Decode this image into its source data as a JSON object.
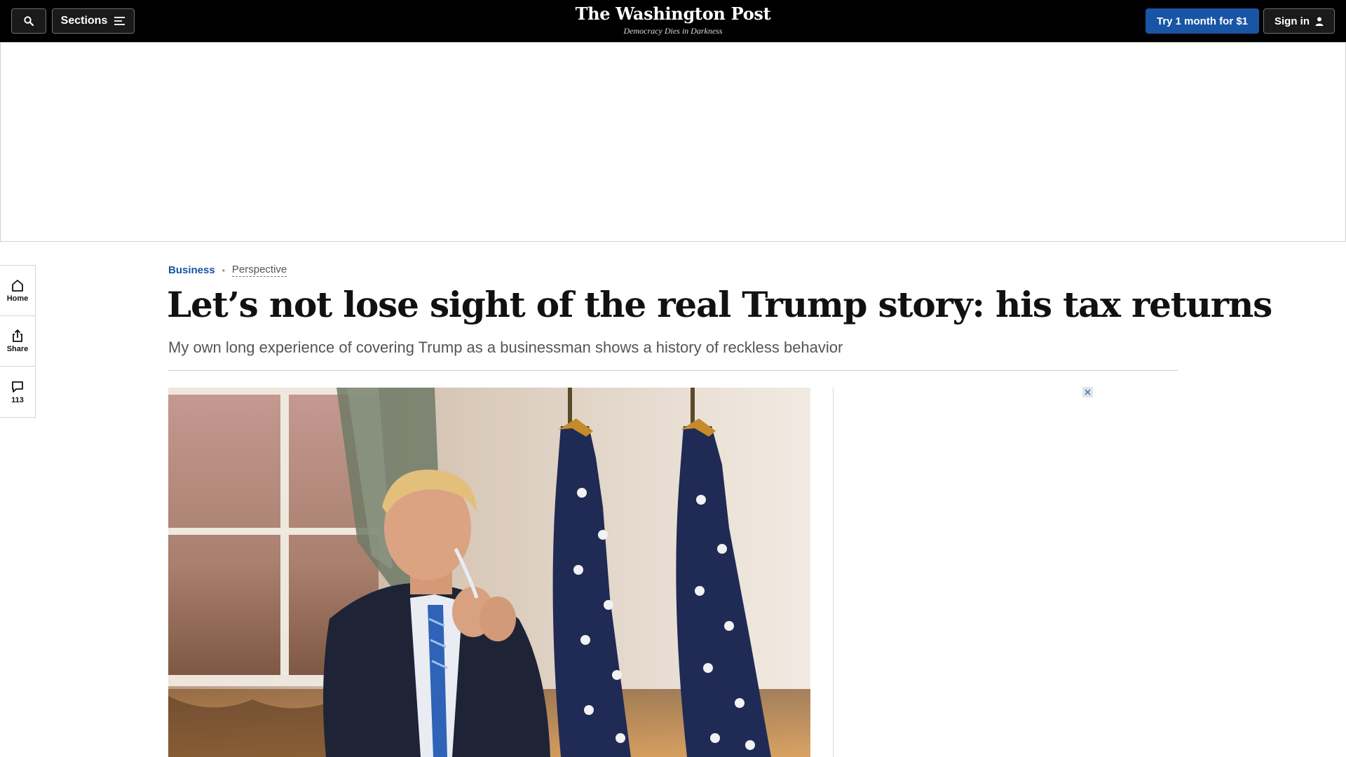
{
  "topbar": {
    "search_icon": "search-icon",
    "sections_label": "Sections",
    "sections_icon": "hamburger-menu-icon",
    "logo": "The Washington Post",
    "tagline": "Democracy Dies in Darkness",
    "trial_button": "Try 1 month for $1",
    "signin_label": "Sign in",
    "signin_icon": "user-icon"
  },
  "rail": {
    "items": [
      {
        "label": "Home",
        "icon": "home-icon"
      },
      {
        "label": "Share",
        "icon": "share-icon"
      },
      {
        "label": "113",
        "icon": "comment-icon"
      }
    ]
  },
  "article": {
    "section": "Business",
    "label": "Perspective",
    "headline": "Let’s not lose sight of the real Trump story: his tax returns",
    "subheadline": "My own long experience of covering Trump as a businessman shows a history of reckless behavior"
  },
  "ad": {
    "close_icon": "close-icon"
  },
  "colors": {
    "topbar_bg": "#000000",
    "accent_blue": "#1955a5",
    "section_link": "#1955a5"
  }
}
